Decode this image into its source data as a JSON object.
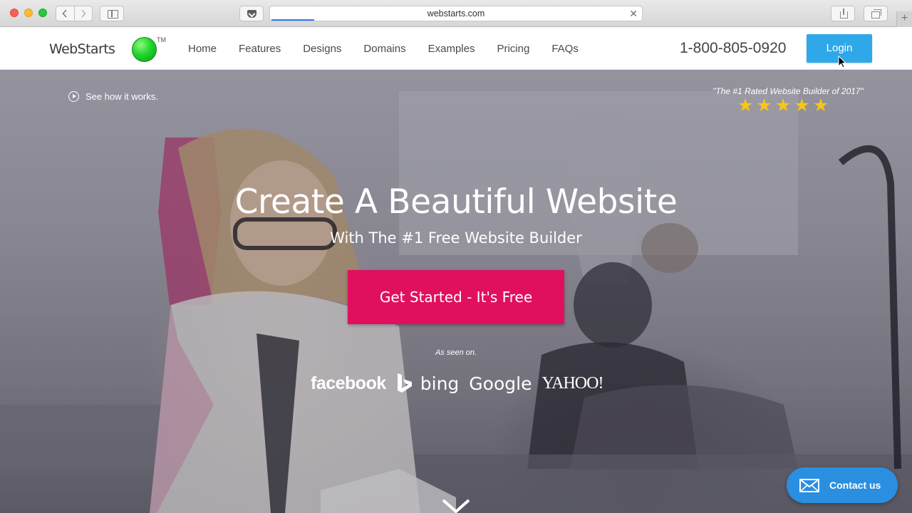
{
  "browser": {
    "url": "webstarts.com",
    "icons": {
      "back": "chevron-left-icon",
      "forward": "chevron-right-icon",
      "sidebar": "sidebar-icon",
      "pocket": "pocket-icon",
      "stop": "close-icon",
      "share": "share-icon",
      "tabs": "tabs-icon",
      "new_tab": "plus-icon"
    },
    "stop_glyph": "✕",
    "new_tab_glyph": "+"
  },
  "header": {
    "logo_text": "WebStarts",
    "logo_tm": "TM",
    "nav": [
      "Home",
      "Features",
      "Designs",
      "Domains",
      "Examples",
      "Pricing",
      "FAQs"
    ],
    "phone": "1-800-805-0920",
    "login_label": "Login"
  },
  "hero": {
    "see_how": "See how it works.",
    "rated_text": "\"The #1 Rated Website Builder of 2017\"",
    "rating": {
      "value": 5,
      "max": 5,
      "glyph": "★"
    },
    "title": "Create A Beautiful Website",
    "subtitle": "With The #1 Free Website Builder",
    "cta_label": "Get Started - It's Free",
    "seen_on": "As seen on.",
    "brands": {
      "facebook": "facebook",
      "bing": "bing",
      "google": "Google",
      "yahoo": "YAHOO!"
    }
  },
  "contact": {
    "label": "Contact us"
  },
  "colors": {
    "login": "#2fa8e9",
    "cta": "#e0105f",
    "contact": "#2a8fe0",
    "star": "#f7c518",
    "logo_ball": "#20d62b"
  }
}
